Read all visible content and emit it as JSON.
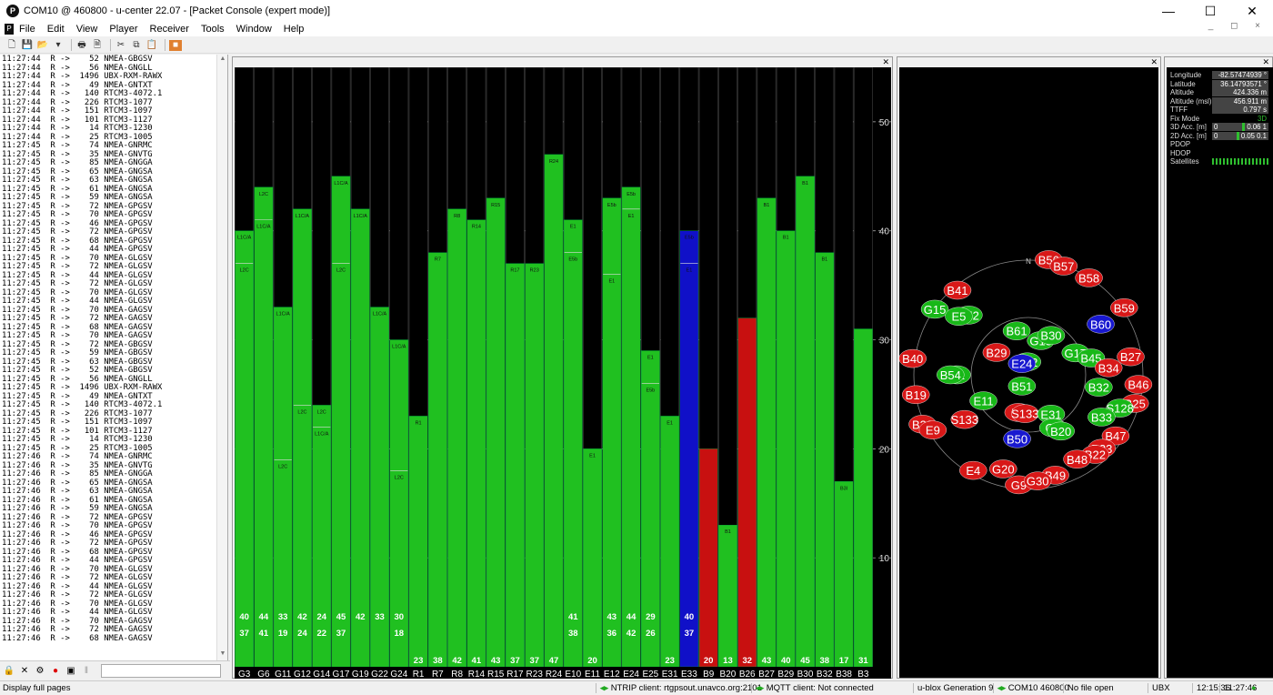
{
  "window": {
    "title": "COM10 @ 460800 - u-center 22.07 - [Packet Console (expert mode)]",
    "app_icon": "u-center-icon",
    "controls": [
      "—",
      "☐",
      "✕"
    ]
  },
  "menu": {
    "items": [
      "File",
      "Edit",
      "View",
      "Player",
      "Receiver",
      "Tools",
      "Window",
      "Help"
    ],
    "mdi_controls": "_ ◻ ×"
  },
  "toolbar": {
    "icons": [
      "new-icon",
      "save-icon",
      "open-icon",
      "dropdown-icon",
      "print-icon",
      "print-preview-icon",
      "cut-icon",
      "copy-icon",
      "paste-icon",
      "stop-icon"
    ]
  },
  "log": {
    "lines": [
      "11:27:44  R ->    52 NMEA-GBGSV",
      "11:27:44  R ->    56 NMEA-GNGLL",
      "11:27:44  R ->  1496 UBX-RXM-RAWX",
      "11:27:44  R ->    49 NMEA-GNTXT",
      "11:27:44  R ->   140 RTCM3-4072.1",
      "11:27:44  R ->   226 RTCM3-1077",
      "11:27:44  R ->   151 RTCM3-1097",
      "11:27:44  R ->   101 RTCM3-1127",
      "11:27:44  R ->    14 RTCM3-1230",
      "11:27:44  R ->    25 RTCM3-1005",
      "11:27:45  R ->    74 NMEA-GNRMC",
      "11:27:45  R ->    35 NMEA-GNVTG",
      "11:27:45  R ->    85 NMEA-GNGGA",
      "11:27:45  R ->    65 NMEA-GNGSA",
      "11:27:45  R ->    63 NMEA-GNGSA",
      "11:27:45  R ->    61 NMEA-GNGSA",
      "11:27:45  R ->    59 NMEA-GNGSA",
      "11:27:45  R ->    72 NMEA-GPGSV",
      "11:27:45  R ->    70 NMEA-GPGSV",
      "11:27:45  R ->    46 NMEA-GPGSV",
      "11:27:45  R ->    72 NMEA-GPGSV",
      "11:27:45  R ->    68 NMEA-GPGSV",
      "11:27:45  R ->    44 NMEA-GPGSV",
      "11:27:45  R ->    70 NMEA-GLGSV",
      "11:27:45  R ->    72 NMEA-GLGSV",
      "11:27:45  R ->    44 NMEA-GLGSV",
      "11:27:45  R ->    72 NMEA-GLGSV",
      "11:27:45  R ->    70 NMEA-GLGSV",
      "11:27:45  R ->    44 NMEA-GLGSV",
      "11:27:45  R ->    70 NMEA-GAGSV",
      "11:27:45  R ->    72 NMEA-GAGSV",
      "11:27:45  R ->    68 NMEA-GAGSV",
      "11:27:45  R ->    70 NMEA-GAGSV",
      "11:27:45  R ->    72 NMEA-GBGSV",
      "11:27:45  R ->    59 NMEA-GBGSV",
      "11:27:45  R ->    63 NMEA-GBGSV",
      "11:27:45  R ->    52 NMEA-GBGSV",
      "11:27:45  R ->    56 NMEA-GNGLL",
      "11:27:45  R ->  1496 UBX-RXM-RAWX",
      "11:27:45  R ->    49 NMEA-GNTXT",
      "11:27:45  R ->   140 RTCM3-4072.1",
      "11:27:45  R ->   226 RTCM3-1077",
      "11:27:45  R ->   151 RTCM3-1097",
      "11:27:45  R ->   101 RTCM3-1127",
      "11:27:45  R ->    14 RTCM3-1230",
      "11:27:45  R ->    25 RTCM3-1005",
      "11:27:46  R ->    74 NMEA-GNRMC",
      "11:27:46  R ->    35 NMEA-GNVTG",
      "11:27:46  R ->    85 NMEA-GNGGA",
      "11:27:46  R ->    65 NMEA-GNGSA",
      "11:27:46  R ->    63 NMEA-GNGSA",
      "11:27:46  R ->    61 NMEA-GNGSA",
      "11:27:46  R ->    59 NMEA-GNGSA",
      "11:27:46  R ->    72 NMEA-GPGSV",
      "11:27:46  R ->    70 NMEA-GPGSV",
      "11:27:46  R ->    46 NMEA-GPGSV",
      "11:27:46  R ->    72 NMEA-GPGSV",
      "11:27:46  R ->    68 NMEA-GPGSV",
      "11:27:46  R ->    44 NMEA-GPGSV",
      "11:27:46  R ->    70 NMEA-GLGSV",
      "11:27:46  R ->    72 NMEA-GLGSV",
      "11:27:46  R ->    44 NMEA-GLGSV",
      "11:27:46  R ->    72 NMEA-GLGSV",
      "11:27:46  R ->    70 NMEA-GLGSV",
      "11:27:46  R ->    44 NMEA-GLGSV",
      "11:27:46  R ->    70 NMEA-GAGSV",
      "11:27:46  R ->    72 NMEA-GAGSV",
      "11:27:46  R ->    68 NMEA-GAGSV"
    ],
    "bottom_icons": [
      "lock-icon",
      "clear-icon",
      "filter-icon",
      "record-icon",
      "save-log-icon",
      "pause-icon"
    ]
  },
  "chart_data": {
    "type": "bar",
    "title": "",
    "ylim": [
      0,
      55
    ],
    "yticks": [
      10,
      20,
      30,
      40,
      50
    ],
    "categories": [
      "G3",
      "G6",
      "G11",
      "G12",
      "G14",
      "G17",
      "G19",
      "G22",
      "G24",
      "R1",
      "R7",
      "R8",
      "R14",
      "R15",
      "R17",
      "R23",
      "R24",
      "E10",
      "E11",
      "E12",
      "E24",
      "E25",
      "E31",
      "E33",
      "B9",
      "B20",
      "B26",
      "B27",
      "B29",
      "B30",
      "B32",
      "B38",
      "B3"
    ],
    "series": [
      {
        "name": "L1",
        "values": [
          40,
          44,
          33,
          42,
          24,
          45,
          42,
          33,
          30,
          23,
          38,
          42,
          41,
          43,
          37,
          37,
          47,
          41,
          20,
          43,
          44,
          29,
          23,
          40,
          20,
          13,
          32,
          43,
          40,
          45,
          38,
          17,
          31
        ]
      },
      {
        "name": "L2",
        "values": [
          37,
          41,
          19,
          24,
          22,
          37,
          0,
          0,
          18,
          0,
          0,
          0,
          0,
          0,
          0,
          0,
          0,
          38,
          0,
          36,
          42,
          26,
          0,
          37,
          0,
          0,
          0,
          0,
          0,
          0,
          0,
          0,
          0
        ]
      }
    ],
    "colors": [
      "green",
      "green",
      "green",
      "green",
      "green",
      "green",
      "green",
      "green",
      "green",
      "green",
      "green",
      "green",
      "green",
      "green",
      "green",
      "green",
      "green",
      "green",
      "green",
      "green",
      "green",
      "green",
      "green",
      "blue",
      "red",
      "green",
      "red",
      "green",
      "green",
      "green",
      "green",
      "green",
      "green"
    ],
    "band_labels": [
      [
        "L1C/A",
        "L2C"
      ],
      [
        "L2C",
        "L1C/A"
      ],
      [
        "L1C/A",
        "L2C"
      ],
      [
        "L1C/A",
        "L2C"
      ],
      [
        "L2C",
        "L1C/A"
      ],
      [
        "L1C/A",
        "L2C"
      ],
      [
        "L1C/A"
      ],
      [
        "L1C/A"
      ],
      [
        "L1C/A",
        "L2C"
      ],
      [
        "R1"
      ],
      [
        "R7"
      ],
      [
        "R8"
      ],
      [
        "R14"
      ],
      [
        "R15"
      ],
      [
        "R17"
      ],
      [
        "R23"
      ],
      [
        "R24"
      ],
      [
        "E1",
        "E5b"
      ],
      [
        "E1"
      ],
      [
        "E5b",
        "E1"
      ],
      [
        "E5b",
        "E1"
      ],
      [
        "E1",
        "E5b"
      ],
      [
        "E1"
      ],
      [
        "E5b",
        "E1"
      ],
      [
        ""
      ],
      [
        "B1"
      ],
      [
        ""
      ],
      [
        "B1"
      ],
      [
        "B1"
      ],
      [
        "B1"
      ],
      [
        "B1"
      ],
      [
        "B3I"
      ],
      [
        ""
      ]
    ]
  },
  "sky": {
    "north_label": "N",
    "sats": [
      {
        "id": "B41",
        "c": "r",
        "az": -40,
        "el": 5
      },
      {
        "id": "B56",
        "c": "r",
        "az": 10,
        "el": 0
      },
      {
        "id": "B57",
        "c": "r",
        "az": 18,
        "el": 2
      },
      {
        "id": "B58",
        "c": "r",
        "az": 32,
        "el": 2
      },
      {
        "id": "B59",
        "c": "r",
        "az": 55,
        "el": 0
      },
      {
        "id": "G15",
        "c": "g",
        "az": -55,
        "el": 2
      },
      {
        "id": "B52",
        "c": "g",
        "az": -45,
        "el": 25
      },
      {
        "id": "E5",
        "c": "g",
        "az": -50,
        "el": 20
      },
      {
        "id": "B60",
        "c": "b",
        "az": 55,
        "el": 22
      },
      {
        "id": "B40",
        "c": "r",
        "az": -82,
        "el": -2
      },
      {
        "id": "B61",
        "c": "g",
        "az": -15,
        "el": 55
      },
      {
        "id": "G13",
        "c": "g",
        "az": 20,
        "el": 62
      },
      {
        "id": "B30",
        "c": "g",
        "az": 30,
        "el": 55
      },
      {
        "id": "G17",
        "c": "g",
        "az": 65,
        "el": 50
      },
      {
        "id": "B45",
        "c": "g",
        "az": 75,
        "el": 40
      },
      {
        "id": "B34",
        "c": "r",
        "az": 85,
        "el": 28
      },
      {
        "id": "B27",
        "c": "r",
        "az": 80,
        "el": 10
      },
      {
        "id": "B29",
        "c": "r",
        "az": -55,
        "el": 60
      },
      {
        "id": "E12",
        "c": "g",
        "az": -5,
        "el": 80
      },
      {
        "id": "E24",
        "c": "b",
        "az": -30,
        "el": 80
      },
      {
        "id": "B51",
        "c": "g",
        "az": -150,
        "el": 80
      },
      {
        "id": "G1",
        "c": "g",
        "az": -90,
        "el": 35
      },
      {
        "id": "B54",
        "c": "g",
        "az": -90,
        "el": 30
      },
      {
        "id": "B46",
        "c": "r",
        "az": 95,
        "el": 5
      },
      {
        "id": "B19",
        "c": "r",
        "az": -100,
        "el": 2
      },
      {
        "id": "B32",
        "c": "g",
        "az": 100,
        "el": 35
      },
      {
        "id": "B25",
        "c": "r",
        "az": 105,
        "el": 5
      },
      {
        "id": "E11",
        "c": "g",
        "az": -120,
        "el": 50
      },
      {
        "id": "S128",
        "c": "g",
        "az": 110,
        "el": 15
      },
      {
        "id": "B39",
        "c": "r",
        "az": -115,
        "el": 0
      },
      {
        "id": "E9",
        "c": "r",
        "az": -120,
        "el": 5
      },
      {
        "id": "S133",
        "c": "r",
        "az": -125,
        "el": 30
      },
      {
        "id": "B9",
        "c": "r",
        "az": -165,
        "el": 60
      },
      {
        "id": "S133",
        "c": "r",
        "az": -175,
        "el": 60
      },
      {
        "id": "E31",
        "c": "g",
        "az": 150,
        "el": 55
      },
      {
        "id": "B33",
        "c": "g",
        "az": 120,
        "el": 25
      },
      {
        "id": "B47",
        "c": "r",
        "az": 125,
        "el": 8
      },
      {
        "id": "G2",
        "c": "g",
        "az": 155,
        "el": 45
      },
      {
        "id": "B20",
        "c": "g",
        "az": 150,
        "el": 40
      },
      {
        "id": "B23",
        "c": "r",
        "az": 135,
        "el": 10
      },
      {
        "id": "B50",
        "c": "b",
        "az": -170,
        "el": 40
      },
      {
        "id": "B22",
        "c": "r",
        "az": 140,
        "el": 10
      },
      {
        "id": "B48",
        "c": "r",
        "az": 150,
        "el": 15
      },
      {
        "id": "E4",
        "c": "r",
        "az": -150,
        "el": 5
      },
      {
        "id": "G20",
        "c": "r",
        "az": -165,
        "el": 15
      },
      {
        "id": "B49",
        "c": "r",
        "az": 165,
        "el": 10
      },
      {
        "id": "G9",
        "c": "r",
        "az": -175,
        "el": 5
      },
      {
        "id": "G30",
        "c": "r",
        "az": 175,
        "el": 8
      }
    ]
  },
  "data_view": {
    "rows": [
      {
        "label": "Longitude",
        "value": "-82.57474939 °"
      },
      {
        "label": "Latitude",
        "value": "36.14793571 °"
      },
      {
        "label": "Altitude",
        "value": "424.336 m"
      },
      {
        "label": "Altitude (msl)",
        "value": "456.911 m"
      },
      {
        "label": "TTFF",
        "value": "0.797 s"
      },
      {
        "label": "Fix Mode",
        "value": "3D"
      },
      {
        "label": "3D Acc. [m]",
        "value": "0",
        "value2": "0.06 1"
      },
      {
        "label": "2D Acc. [m]",
        "value": "0",
        "value2": "0.05 0.1"
      },
      {
        "label": "PDOP",
        "value": ""
      },
      {
        "label": "HDOP",
        "value": ""
      },
      {
        "label": "Satellites",
        "value": ""
      }
    ]
  },
  "status": {
    "left": "Display full pages",
    "ntrip": "NTRIP client: rtgpsout.unavco.org:2101",
    "mqtt": "MQTT client: Not connected",
    "generation": "u-blox Generation 9",
    "port": "COM10 460800",
    "file": "No file open",
    "protocol": "UBX",
    "time1": "12:15:36",
    "time2": "11:27:46"
  }
}
